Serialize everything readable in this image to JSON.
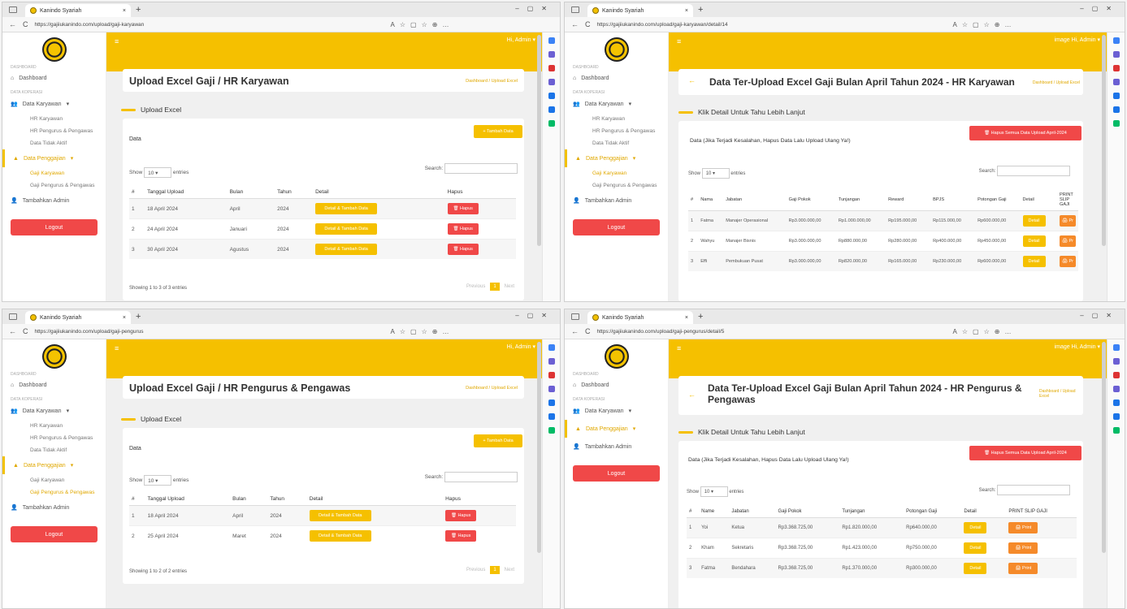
{
  "browser": {
    "app_name": "Kanindo Syariah",
    "new_tab": "+",
    "back": "←",
    "reload": "C"
  },
  "site": {
    "admin": "Hi, Admin ▾",
    "admin2": "image Hi, Admin ▾",
    "menu_icon": "≡",
    "sidebar": {
      "header_dashboard": "DASHBOARD",
      "dashboard": "Dashboard",
      "header_data": "DATA KOPERASI",
      "data_karyawan": "Data Karyawan",
      "hr_karyawan": "HR Karyawan",
      "hr_pengurus": "HR Pengurus & Pengawas",
      "data_tidak_aktif": "Data Tidak Aktif",
      "data_penggajian": "Data Penggajian",
      "gaji_karyawan": "Gaji Karyawan",
      "gaji_pengurus": "Gaji Pengurus & Pengawas",
      "tambahkan_admin": "Tambahkan Admin",
      "logout": "Logout"
    }
  },
  "p1": {
    "url": "https://gajiiukanindo.com/upload/gaji-karyawan",
    "title": "Upload Excel Gaji / HR Karyawan",
    "crumb": "Dashboard / Upload Excel",
    "section": "Upload Excel",
    "tambah": "+ Tambah Data",
    "data_label": "Data",
    "show": "Show",
    "entries": "entries",
    "length": "10",
    "search": "Search:",
    "cols": [
      "#",
      "Tanggal Upload",
      "Bulan",
      "Tahun",
      "Detail",
      "Hapus"
    ],
    "rows": [
      {
        "n": "1",
        "t": "18 April 2024",
        "b": "April",
        "y": "2024"
      },
      {
        "n": "2",
        "t": "24 April 2024",
        "b": "Januari",
        "y": "2024"
      },
      {
        "n": "3",
        "t": "30 April 2024",
        "b": "Agustus",
        "y": "2024"
      }
    ],
    "detail_btn": "Detail & Tambah Data",
    "hapus_btn": "🗑 Hapus",
    "showing": "Showing 1 to 3 of 3 entries",
    "prev": "Previous",
    "page": "1",
    "next": "Next"
  },
  "p2": {
    "url": "https://gajiiukanindo.com/upload/gaji-karyawan/detail/14",
    "title": "Data Ter-Upload Excel Gaji Bulan April Tahun 2024 - HR Karyawan",
    "crumb": "Dashboard / Upload Excel",
    "back": "←",
    "section": "Klik Detail Untuk Tahu Lebih Lanjut",
    "note": "Data (Jika Terjadi Kesalahan, Hapus Data Lalu Upload Ulang Ya!)",
    "hapus_all": "🗑 Hapus Semua Data Upload April-2024",
    "show": "Show",
    "entries": "entries",
    "length": "10",
    "search": "Search:",
    "cols": [
      "#",
      "Nama",
      "Jabatan",
      "Gaji Pokok",
      "Tunjangan",
      "Reward",
      "BPJS",
      "Potongan Gaji",
      "Detail",
      "PRINT SLIP GAJI"
    ],
    "rows": [
      {
        "n": "1",
        "nm": "Fatma",
        "j": "Manajer Operasional",
        "g": "Rp3.000.000,00",
        "t": "Rp1.000.000,00",
        "r": "Rp195.000,00",
        "b": "Rp115.000,00",
        "p": "Rp600.000,00"
      },
      {
        "n": "2",
        "nm": "Wahyu",
        "j": "Manajer Bisnis",
        "g": "Rp3.000.000,00",
        "t": "Rp880.000,00",
        "r": "Rp280.000,00",
        "b": "Rp400.000,00",
        "p": "Rp450.000,00"
      },
      {
        "n": "3",
        "nm": "Effi",
        "j": "Pembukuan Pusat",
        "g": "Rp3.000.000,00",
        "t": "Rp820.000,00",
        "r": "Rp165.000,00",
        "b": "Rp230.000,00",
        "p": "Rp600.000,00"
      }
    ],
    "detail_btn": "Detail",
    "print_btn": "🖨 Pr"
  },
  "p3": {
    "url": "https://gajiiukanindo.com/upload/gaji-pengurus",
    "title": "Upload Excel Gaji / HR Pengurus & Pengawas",
    "crumb": "Dashboard / Upload Excel",
    "section": "Upload Excel",
    "tambah": "+ Tambah Data",
    "data_label": "Data",
    "show": "Show",
    "entries": "entries",
    "length": "10",
    "search": "Search:",
    "cols": [
      "#",
      "Tanggal Upload",
      "Bulan",
      "Tahun",
      "Detail",
      "Hapus"
    ],
    "rows": [
      {
        "n": "1",
        "t": "18 April 2024",
        "b": "April",
        "y": "2024"
      },
      {
        "n": "2",
        "t": "25 April 2024",
        "b": "Maret",
        "y": "2024"
      }
    ],
    "detail_btn": "Detail & Tambah Data",
    "hapus_btn": "🗑 Hapus",
    "showing": "Showing 1 to 2 of 2 entries",
    "prev": "Previous",
    "page": "1",
    "next": "Next"
  },
  "p4": {
    "url": "https://gajiiukanindo.com/upload/gaji-pengurus/detail/5",
    "title": "Data Ter-Upload Excel Gaji Bulan April Tahun 2024 - HR Pengurus & Pengawas",
    "crumb": "Dashboard / Upload Excel",
    "back": "←",
    "section": "Klik Detail Untuk Tahu Lebih Lanjut",
    "note": "Data (Jika Terjadi Kesalahan, Hapus Data Lalu Upload Ulang Ya!)",
    "hapus_all": "🗑 Hapus Semua Data Upload April-2024",
    "show": "Show",
    "entries": "entries",
    "length": "10",
    "search": "Search:",
    "cols": [
      "#",
      "Name",
      "Jabatan",
      "Gaji Pokok",
      "Tunjangan",
      "Potongan Gaji",
      "Detail",
      "PRINT SLIP GAJI"
    ],
    "rows": [
      {
        "n": "1",
        "nm": "Yoi",
        "j": "Ketua",
        "g": "Rp3.368.725,00",
        "t": "Rp1.820.000,00",
        "p": "Rp640.000,00"
      },
      {
        "n": "2",
        "nm": "Kham",
        "j": "Sekretaris",
        "g": "Rp3.368.725,00",
        "t": "Rp1.423.000,00",
        "p": "Rp750.000,00"
      },
      {
        "n": "3",
        "nm": "Fatma",
        "j": "Bendahara",
        "g": "Rp3.368.725,00",
        "t": "Rp1.370.000,00",
        "p": "Rp300.000,00"
      }
    ],
    "detail_btn": "Detail",
    "print_btn": "🖨 Print"
  }
}
